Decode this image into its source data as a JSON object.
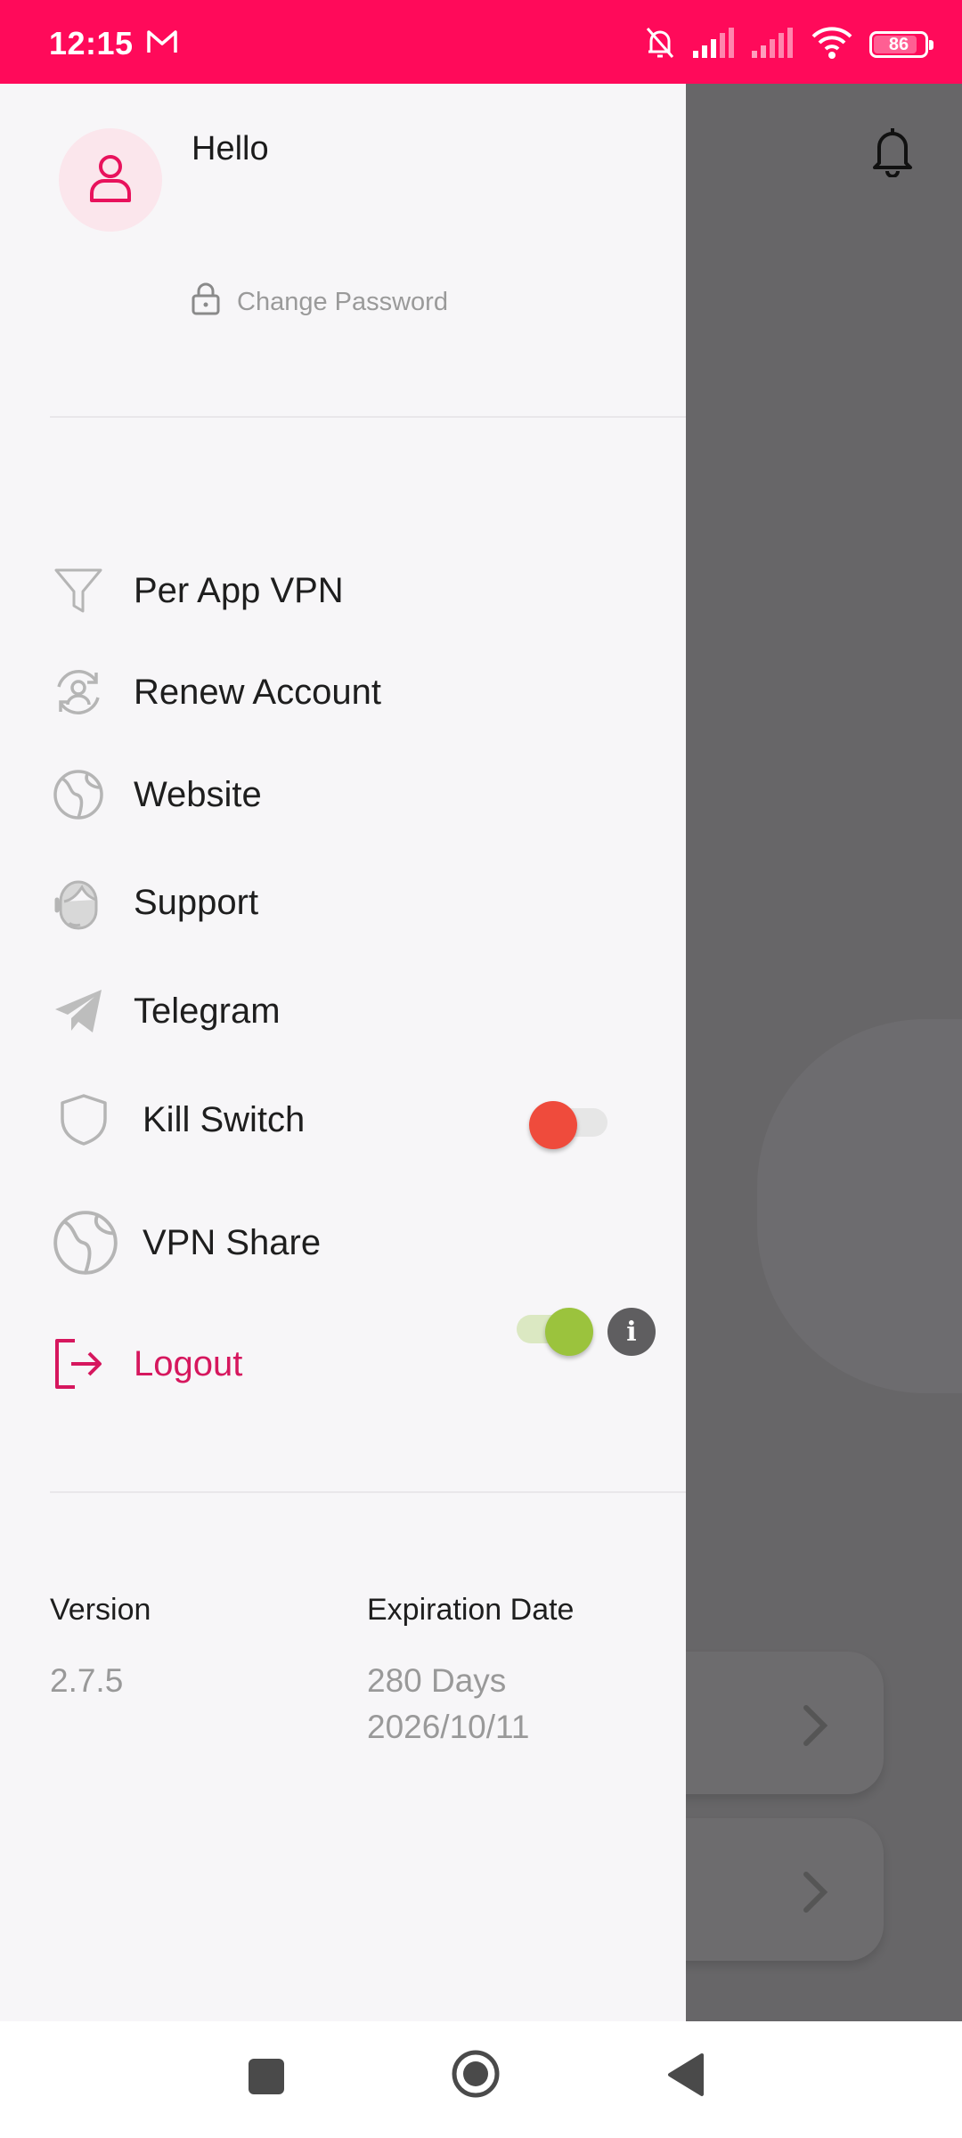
{
  "status_bar": {
    "time": "12:15",
    "battery": "86",
    "battery_level": 0.86,
    "icons": [
      "gmail-icon",
      "muted-bell-icon",
      "signal-icon",
      "signal-icon",
      "wifi-icon",
      "battery-icon"
    ],
    "background_color": "#ff0a5a"
  },
  "drawer": {
    "greeting": "Hello",
    "change_password": "Change Password",
    "menu": [
      {
        "label": "Per App VPN",
        "icon": "funnel-icon"
      },
      {
        "label": "Renew Account",
        "icon": "refresh-user-icon"
      },
      {
        "label": "Website",
        "icon": "globe-icon"
      },
      {
        "label": "Support",
        "icon": "support-agent-icon"
      },
      {
        "label": "Telegram",
        "icon": "telegram-icon"
      }
    ],
    "kill_switch": {
      "label": "Kill Switch",
      "icon": "shield-icon",
      "enabled": false,
      "thumb_color": "#ef4b3c"
    },
    "vpn_share": {
      "label": "VPN Share",
      "icon": "globe-icon",
      "enabled": true,
      "thumb_color": "#9bc33d"
    },
    "logout": {
      "label": "Logout",
      "icon": "logout-icon",
      "color": "#d6175e"
    }
  },
  "footer": {
    "version_label": "Version",
    "version_value": "2.7.5",
    "expiration_label": "Expiration Date",
    "expiration_days": "280 Days",
    "expiration_date": "2026/10/11"
  },
  "accent_color": "#ff0a5a"
}
